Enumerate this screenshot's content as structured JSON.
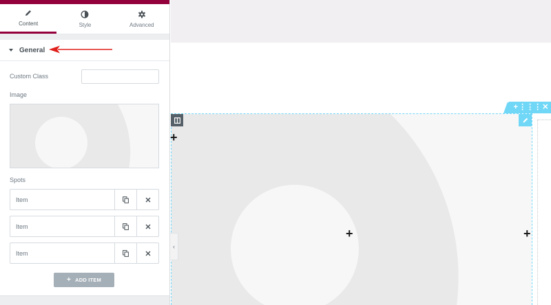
{
  "panel": {
    "tabs": [
      {
        "label": "Content",
        "icon": "pencil-icon",
        "active": true
      },
      {
        "label": "Style",
        "icon": "half-circle-icon",
        "active": false
      },
      {
        "label": "Advanced",
        "icon": "gear-icon",
        "active": false
      }
    ],
    "section": {
      "title": "General",
      "expanded": true
    },
    "custom_class": {
      "label": "Custom Class",
      "value": ""
    },
    "image": {
      "label": "Image"
    },
    "spots": {
      "label": "Spots",
      "items": [
        {
          "title": "Item"
        },
        {
          "title": "Item"
        },
        {
          "title": "Item"
        }
      ]
    },
    "add_item_label": "ADD ITEM"
  },
  "colors": {
    "brand": "#93003c",
    "section_accent": "#71d7f7",
    "annotation_arrow": "#e0201b",
    "button": "#a4afb7"
  }
}
